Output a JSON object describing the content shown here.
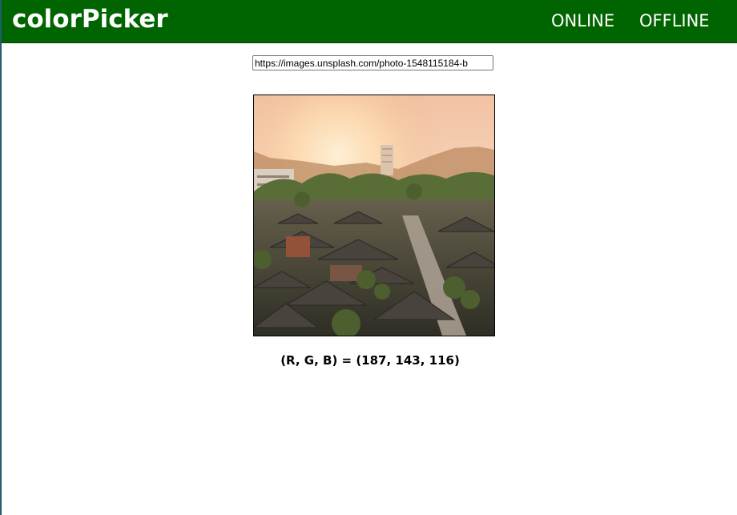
{
  "header": {
    "brand": "colorPicker",
    "nav": [
      "ONLINE",
      "OFFLINE"
    ],
    "background_color": "#006400"
  },
  "url_input": {
    "value": "https://images.unsplash.com/photo-1548115184-b"
  },
  "image": {
    "description_icon": "photo-of-rooftops-at-sunset"
  },
  "readout": {
    "text": "(R, G, B) = (187, 143, 116)",
    "rgb": [
      187,
      143,
      116
    ]
  }
}
